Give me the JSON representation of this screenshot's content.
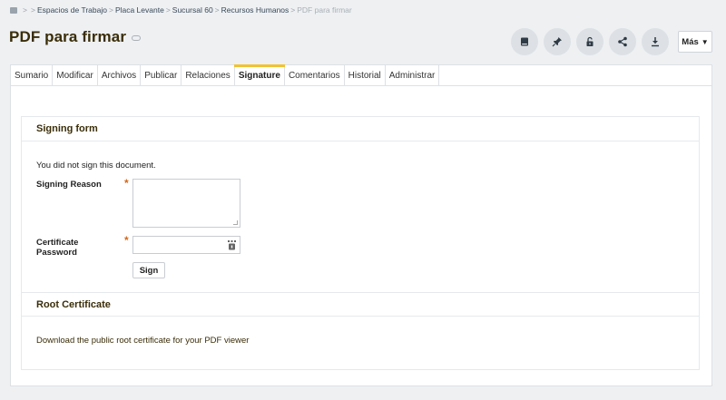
{
  "breadcrumb": {
    "items": [
      "Espacios de Trabajo",
      "Placa Levante",
      "Sucursal 60",
      "Recursos Humanos"
    ],
    "current": "PDF para firmar"
  },
  "page": {
    "title": "PDF para firmar"
  },
  "actions": {
    "more_label": "Más",
    "icons": [
      "book-icon",
      "pin-icon",
      "unlock-icon",
      "share-icon",
      "download-icon"
    ]
  },
  "tabs": [
    {
      "label": "Sumario"
    },
    {
      "label": "Modificar"
    },
    {
      "label": "Archivos"
    },
    {
      "label": "Publicar"
    },
    {
      "label": "Relaciones"
    },
    {
      "label": "Signature",
      "active": true
    },
    {
      "label": "Comentarios"
    },
    {
      "label": "Historial"
    },
    {
      "label": "Administrar"
    }
  ],
  "signing_form": {
    "heading": "Signing form",
    "status_message": "You did not sign this document.",
    "reason_label": "Signing Reason",
    "reason_value": "",
    "password_label_line1": "Certificate",
    "password_label_line2": "Password",
    "password_value": "",
    "required_mark": "*",
    "sign_button": "Sign"
  },
  "root_certificate": {
    "heading": "Root Certificate",
    "link_text": "Download the public root certificate for your PDF viewer"
  },
  "colors": {
    "accent_tab": "#f1c232",
    "title_text": "#3a2d08",
    "required": "#d2691e"
  }
}
